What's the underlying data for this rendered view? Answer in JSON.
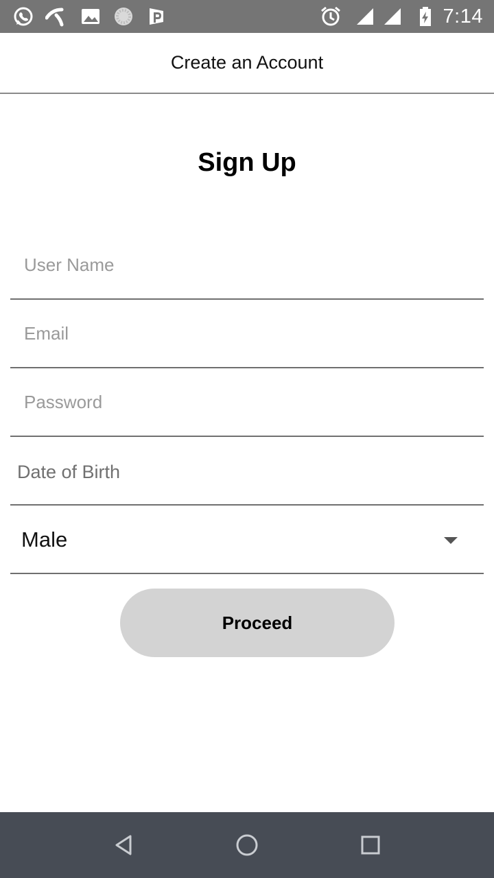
{
  "status_bar": {
    "time": "7:14",
    "left_icons": [
      "whatsapp-icon",
      "telenor-icon",
      "gallery-icon",
      "loading-icon",
      "parking-app-icon"
    ],
    "right_icons": [
      "alarm-icon",
      "signal-icon",
      "signal-icon",
      "battery-charging-icon"
    ]
  },
  "header": {
    "title": "Create an Account"
  },
  "form": {
    "heading": "Sign Up",
    "username_placeholder": "User Name",
    "email_placeholder": "Email",
    "password_placeholder": "Password",
    "dob_label": "Date of Birth",
    "gender_value": "Male",
    "proceed_label": "Proceed"
  },
  "nav_bar": {
    "buttons": [
      "back-icon",
      "home-icon",
      "recents-icon"
    ]
  },
  "colors": {
    "status_bar": "#757575",
    "nav_bar": "#474c55",
    "button": "#d3d3d3",
    "divider": "#6f6f6f"
  }
}
